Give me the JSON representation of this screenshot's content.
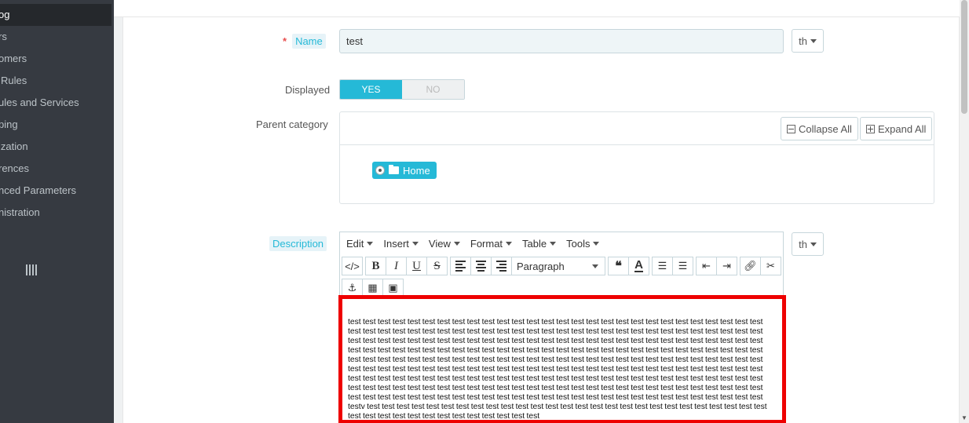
{
  "sidebar": {
    "items": [
      {
        "label": "Catalog",
        "active": true
      },
      {
        "label": "Orders"
      },
      {
        "label": "Customers"
      },
      {
        "label": "Price Rules"
      },
      {
        "label": "Modules and Services"
      },
      {
        "label": "Shipping"
      },
      {
        "label": "Localization"
      },
      {
        "label": "Preferences"
      },
      {
        "label": "Advanced Parameters"
      },
      {
        "label": "Administration"
      }
    ],
    "visible_text": [
      "og",
      "rs",
      "omers",
      "Rules",
      "ules and Services",
      "ping",
      "ization",
      "rences",
      "nced Parameters",
      "nistration"
    ],
    "toggle_icon": "bars-vertical-icon"
  },
  "form": {
    "name": {
      "label": "Name",
      "required_mark": "*",
      "value": "test",
      "lang": "th"
    },
    "displayed": {
      "label": "Displayed",
      "yes": "YES",
      "no": "NO",
      "selected": "YES"
    },
    "parent_category": {
      "label": "Parent category",
      "collapse_label": "Collapse All",
      "expand_label": "Expand All",
      "node": "Home"
    },
    "description": {
      "label": "Description",
      "lang": "th",
      "menu": [
        "Edit",
        "Insert",
        "View",
        "Format",
        "Table",
        "Tools"
      ],
      "format_select": "Paragraph",
      "content": "test test test test test test test test test test test test test test test test test test test test test test test test test test test test test test test test test test test test test test test test test test test test test test test test test test test test test test test test test test test test test test test test test test test test test test test test test test test test test test test test test test test test test test test test test test test test test test test test test test test test test test test test test test test test test test test test test test test test test test test test test test test test test test test test test test test test test test test test test test test test test test test test test test test test test test test test test test test test test test test test test test test test test test test test test test test test test test test test test test test test test test test test test test test test test test test test test test test test test test test test test test test test test test test test test test test test test test test test test test test test test test test test test test test test test test test test test test test test test test test test test test test test test test test test test test test test testv test test test test test test test test test test test test test test test test test test test test test test test test test test test test test test test test test test test test test test test test"
    }
  },
  "colors": {
    "accent": "#25b9d7",
    "sidebar_bg": "#363a41",
    "highlight": "#ee0000"
  }
}
